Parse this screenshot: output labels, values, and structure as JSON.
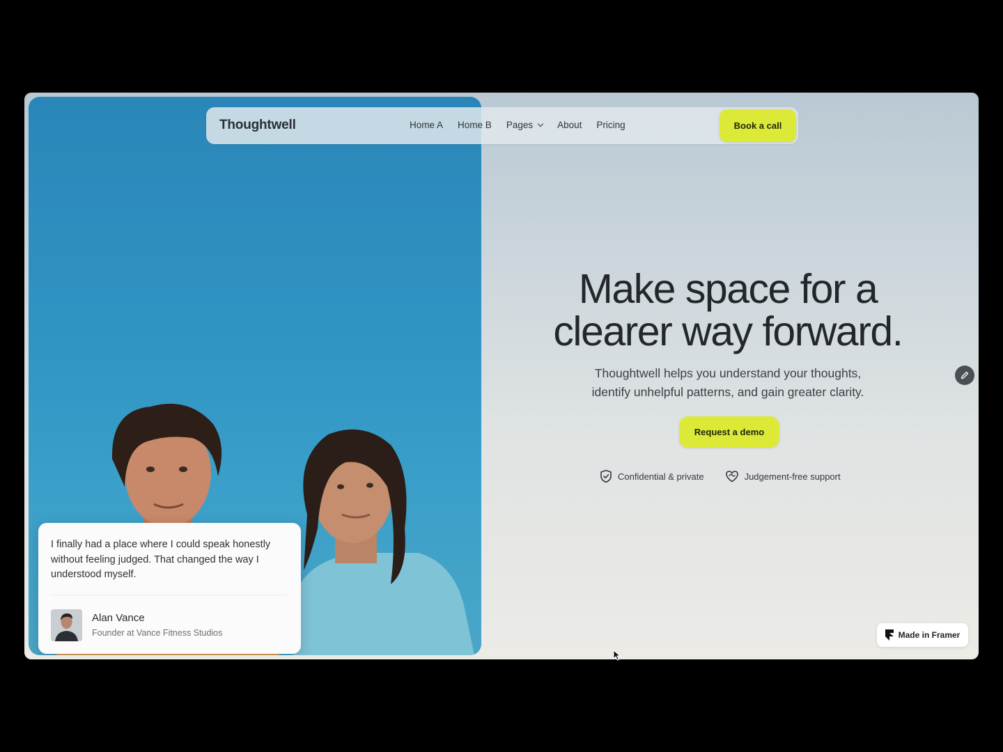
{
  "header": {
    "brand": "Thoughtwell",
    "nav_items": [
      {
        "label": "Home A"
      },
      {
        "label": "Home B"
      },
      {
        "label": "Pages",
        "has_dropdown": true
      },
      {
        "label": "About"
      },
      {
        "label": "Pricing"
      }
    ],
    "cta_label": "Book a call"
  },
  "hero": {
    "headline_line1": "Make space for a",
    "headline_line2": "clearer way forward.",
    "subtitle_line1": "Thoughtwell helps you understand your thoughts,",
    "subtitle_line2": "identify unhelpful patterns, and gain greater clarity.",
    "cta_label": "Request a demo",
    "badges": [
      {
        "icon": "shield-check-icon",
        "label": "Confidential & private"
      },
      {
        "icon": "heart-handshake-icon",
        "label": "Judgement-free support"
      }
    ]
  },
  "testimonial": {
    "quote": "I finally had a place where I could speak honestly without feeling judged. That changed the way I understood myself.",
    "author_name": "Alan Vance",
    "author_role": "Founder at Vance Fitness Studios"
  },
  "framer_badge": {
    "label": "Made in Framer",
    "icon": "framer-icon"
  },
  "colors": {
    "accent": "#dcea37",
    "sky": "#3195c4",
    "text_dark": "#23272a"
  }
}
